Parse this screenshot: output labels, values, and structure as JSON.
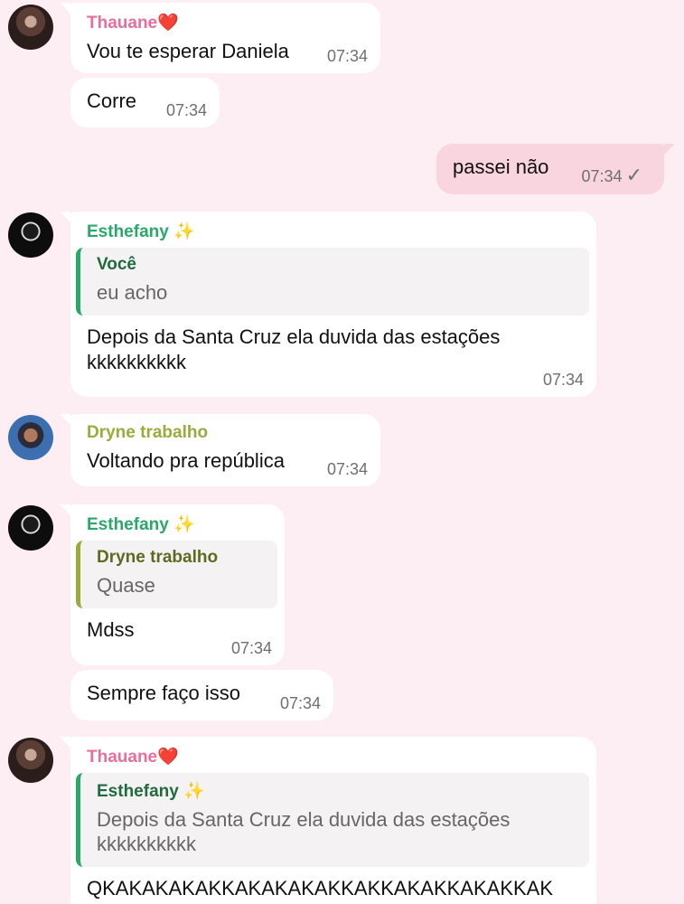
{
  "messages": [
    {
      "sender": "Thauane",
      "sender_emoji": "❤️",
      "text": "Vou te esperar Daniela",
      "time": "07:34"
    },
    {
      "text": "Corre",
      "time": "07:34"
    },
    {
      "outgoing": true,
      "text": "passei não",
      "time": "07:34",
      "status_icon": "check-icon"
    },
    {
      "sender": "Esthefany",
      "sender_emoji": "✨",
      "reply_name": "Você",
      "reply_text": "eu acho",
      "text_line1": "Depois da Santa Cruz ela duvida das estações",
      "text_line2": "kkkkkkkkkk",
      "time": "07:34"
    },
    {
      "sender": "Dryne trabalho",
      "text": "Voltando pra república",
      "time": "07:34"
    },
    {
      "sender": "Esthefany",
      "sender_emoji": "✨",
      "reply_name": "Dryne trabalho",
      "reply_text": "Quase",
      "text": "Mdss",
      "time": "07:34"
    },
    {
      "text": "Sempre faço isso",
      "time": "07:34"
    },
    {
      "sender": "Thauane",
      "sender_emoji": "❤️",
      "reply_name": "Esthefany",
      "reply_emoji": "✨",
      "reply_text_line1": "Depois da Santa Cruz ela duvida das estações",
      "reply_text_line2": "kkkkkkkkkk",
      "text": "QKAKAKAKAKKAKAKAKAKKAKKAKAKKAKAKKAK"
    }
  ],
  "colors": {
    "background": "#fdeef3",
    "outgoing_bubble": "#f9d5df",
    "incoming_bubble": "#ffffff",
    "thauane": "#e96e9a",
    "esthefany": "#2aa86a",
    "dryne": "#9aab3a"
  }
}
